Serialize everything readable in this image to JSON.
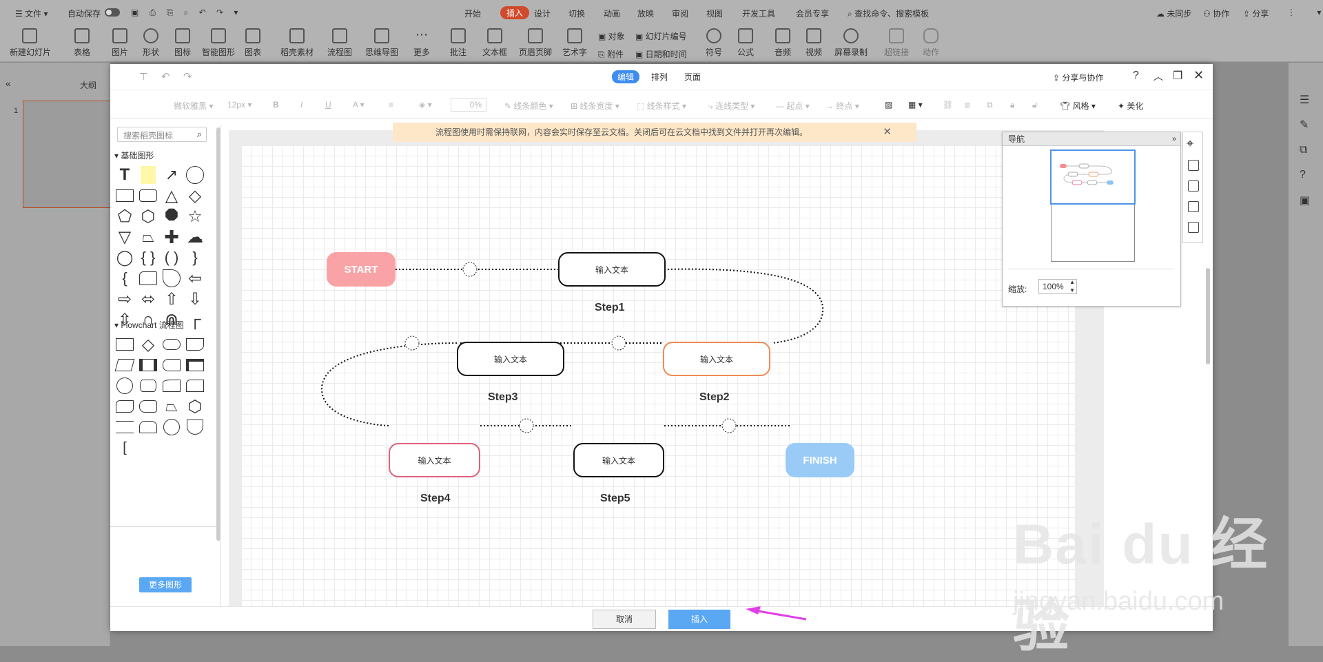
{
  "menubar": {
    "file": "文件",
    "autosave": "自动保存",
    "tabs": [
      "开始",
      "插入",
      "设计",
      "切换",
      "动画",
      "放映",
      "审阅",
      "视图",
      "开发工具",
      "会员专享"
    ],
    "search": "查找命令、搜索模板",
    "right": [
      "未同步",
      "协作",
      "分享"
    ]
  },
  "ribbon": {
    "items": [
      "新建幻灯片",
      "表格",
      "图片",
      "形状",
      "图标",
      "智能图形",
      "图表",
      "稻壳素材",
      "流程图",
      "思维导图",
      "更多",
      "批注",
      "文本框",
      "页眉页脚",
      "艺术字",
      "符号",
      "公式",
      "音频",
      "视频",
      "屏幕录制",
      "超链接",
      "动作"
    ],
    "small": [
      "对象",
      "幻灯片编号",
      "附件",
      "日期和时间"
    ]
  },
  "leftpanel": {
    "tab": "大纲",
    "slide_num": "1"
  },
  "dialog": {
    "tabs": [
      "编辑",
      "排列",
      "页面"
    ],
    "share": "分享与协作",
    "toolbar": [
      "微软雅黑",
      "12px",
      "B",
      "I",
      "U",
      "A",
      "0%",
      "线条颜色",
      "线条宽度",
      "线条样式",
      "连线类型",
      "起点",
      "终点",
      "风格",
      "美化"
    ],
    "banner": "流程图使用时需保持联网，内容会实时保存至云文档。关闭后可在云文档中找到文件并打开再次编辑。",
    "shapes_search_placeholder": "搜索稻壳图标",
    "section_basic": "基础图形",
    "section_flow": "Flowchart 流程图",
    "more_shapes": "更多图形",
    "nav_title": "导航",
    "zoom_label": "缩放:",
    "zoom_value": "100%",
    "cancel": "取消",
    "insert": "插入"
  },
  "flow": {
    "start": "START",
    "finish": "FINISH",
    "box_text": "输入文本",
    "steps": [
      "Step1",
      "Step2",
      "Step3",
      "Step4",
      "Step5"
    ]
  },
  "colors": {
    "start": "#f9a3a7",
    "finish": "#9acbf7",
    "step2_border": "#ef8a55",
    "step4_border": "#e0607a",
    "accent": "#3d8cf0"
  },
  "watermark": {
    "main": "Bai du 经验",
    "sub": "jingyan.baidu.com"
  }
}
